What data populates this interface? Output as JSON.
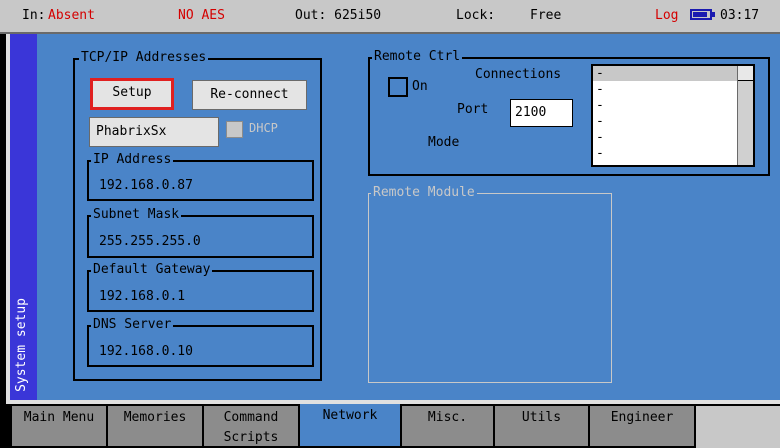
{
  "status": {
    "in_label": "In:",
    "in_value": "Absent",
    "aes": "NO AES",
    "out": "Out: 625i50",
    "lock_label": "Lock:",
    "lock_value": "Free",
    "log": "Log",
    "time": "03:17",
    "battery_icon": "battery-icon"
  },
  "side_label": "System setup",
  "tcpip": {
    "title": "TCP/IP Addresses",
    "setup_button": "Setup",
    "reconnect_button": "Re-connect",
    "hostname": "PhabrixSx",
    "dhcp_label": "DHCP",
    "ip_title": "IP Address",
    "ip_value": "192.168.0.87",
    "subnet_title": "Subnet Mask",
    "subnet_value": "255.255.255.0",
    "gateway_title": "Default Gateway",
    "gateway_value": "192.168.0.1",
    "dns_title": "DNS Server",
    "dns_value": "192.168.0.10"
  },
  "remote_ctrl": {
    "title": "Remote Ctrl",
    "on_label": "On",
    "port_label": "Port",
    "port_value": "2100",
    "mode_label": "Mode",
    "connections_label": "Connections",
    "connections": [
      "-",
      "-",
      "-",
      "-",
      "-",
      "-"
    ]
  },
  "remote_module": {
    "title": "Remote Module"
  },
  "tabs": [
    {
      "label": "Main Menu"
    },
    {
      "label": "Memories"
    },
    {
      "label": "Command Scripts"
    },
    {
      "label": "Network"
    },
    {
      "label": "Misc."
    },
    {
      "label": "Utils"
    },
    {
      "label": "Engineer"
    }
  ]
}
